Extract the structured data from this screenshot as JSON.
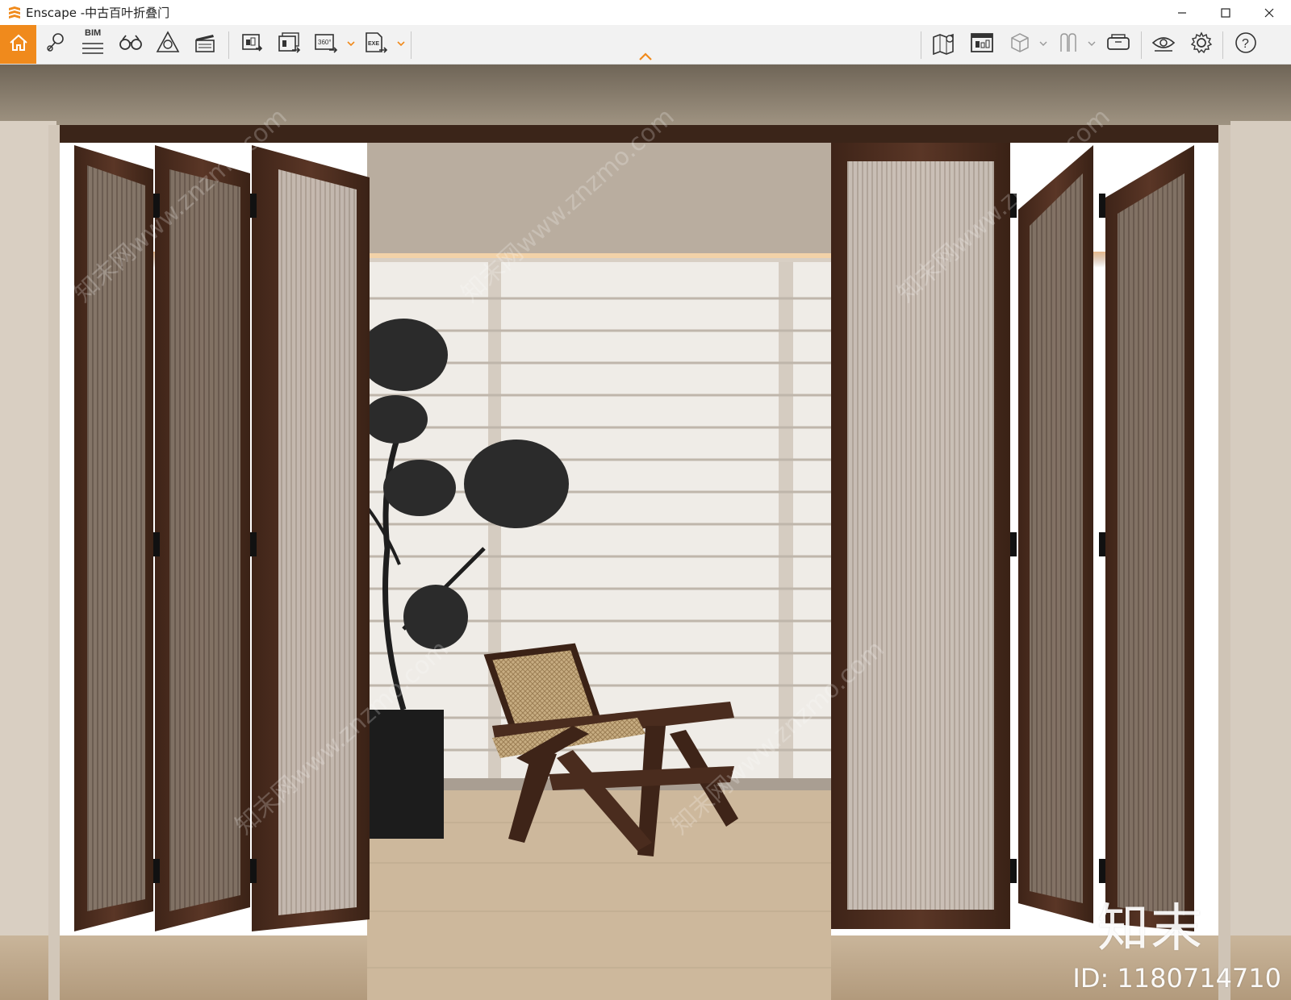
{
  "window": {
    "app_name": "Enscape",
    "title": "Enscape -中古百叶折叠门",
    "controls": {
      "minimize": "—",
      "maximize": "☐",
      "close": "✕"
    }
  },
  "toolbar": {
    "left_items": [
      {
        "name": "home",
        "icon": "home-icon"
      },
      {
        "name": "views",
        "icon": "location-pin-icon"
      },
      {
        "name": "bim",
        "icon": "bim-icon",
        "label": "BIM"
      },
      {
        "name": "binoculars",
        "icon": "binoculars-icon"
      },
      {
        "name": "assets",
        "icon": "asset-library-icon"
      },
      {
        "name": "video",
        "icon": "clapperboard-icon"
      },
      {
        "name": "screenshot",
        "icon": "render-export-icon"
      },
      {
        "name": "batch-render",
        "icon": "batch-render-icon"
      },
      {
        "name": "panorama",
        "icon": "panorama-360-icon",
        "label": "360°"
      },
      {
        "name": "exe-export",
        "icon": "exe-export-icon",
        "label": "EXE"
      }
    ],
    "right_items": [
      {
        "name": "map",
        "icon": "map-icon"
      },
      {
        "name": "preview",
        "icon": "preview-window-icon"
      },
      {
        "name": "cube",
        "icon": "cube-icon"
      },
      {
        "name": "sync",
        "icon": "sync-views-icon"
      },
      {
        "name": "vr",
        "icon": "vr-headset-icon"
      },
      {
        "name": "visual-settings",
        "icon": "eye-icon"
      },
      {
        "name": "settings",
        "icon": "gear-icon"
      },
      {
        "name": "help",
        "icon": "help-icon",
        "label": "?"
      }
    ],
    "accent_color": "#f08a1c"
  },
  "viewport": {
    "watermark_brand": "知末",
    "watermark_id": "ID: 1180714710",
    "watermark_diag": "知末网www.znzmo.com"
  }
}
